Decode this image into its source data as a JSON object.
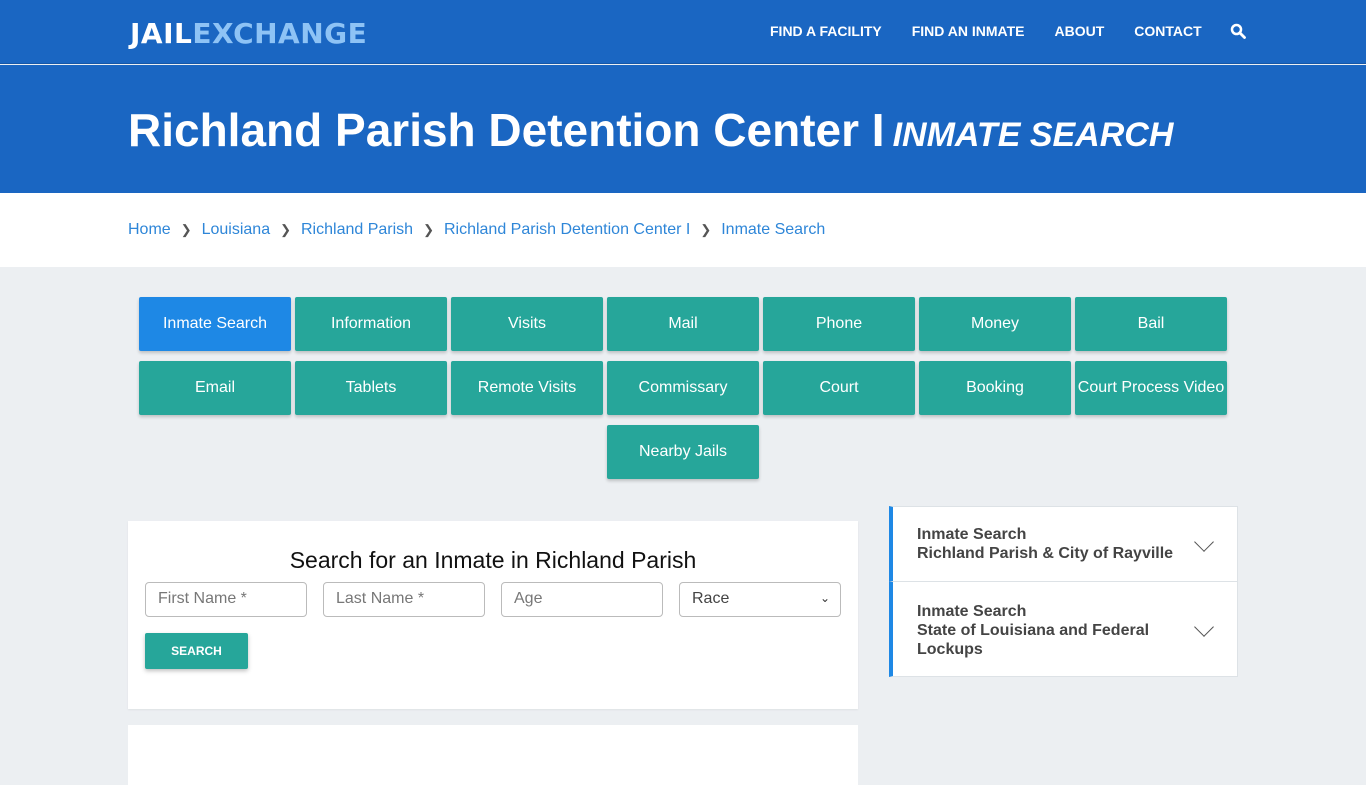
{
  "header": {
    "logo_part1": "JAIL",
    "logo_part2": "EXCHANGE",
    "nav": [
      "FIND A FACILITY",
      "FIND AN INMATE",
      "ABOUT",
      "CONTACT"
    ],
    "search_icon": "search-icon"
  },
  "hero": {
    "title": "Richland Parish Detention Center I",
    "subtitle": "INMATE SEARCH"
  },
  "breadcrumb": [
    "Home",
    "Louisiana",
    "Richland Parish",
    "Richland Parish Detention Center I",
    "Inmate Search"
  ],
  "tabs": [
    "Inmate Search",
    "Information",
    "Visits",
    "Mail",
    "Phone",
    "Money",
    "Bail",
    "Email",
    "Tablets",
    "Remote Visits",
    "Commissary",
    "Court",
    "Booking",
    "Court Process Video",
    "Nearby Jails"
  ],
  "active_tab": "Inmate Search",
  "search_form": {
    "title": "Search for an Inmate in Richland Parish",
    "first_name_placeholder": "First Name *",
    "last_name_placeholder": "Last Name *",
    "age_placeholder": "Age",
    "race_selected": "Race",
    "button": "SEARCH"
  },
  "sidebar": [
    {
      "line1": "Inmate Search",
      "line2": "Richland Parish & City of Rayville"
    },
    {
      "line1": "Inmate Search",
      "line2": "State of Louisiana and Federal Lockups"
    }
  ],
  "colors": {
    "brand_blue": "#1a66c2",
    "teal": "#26a69a",
    "active_blue": "#1e88e5",
    "link": "#2e86d8"
  }
}
